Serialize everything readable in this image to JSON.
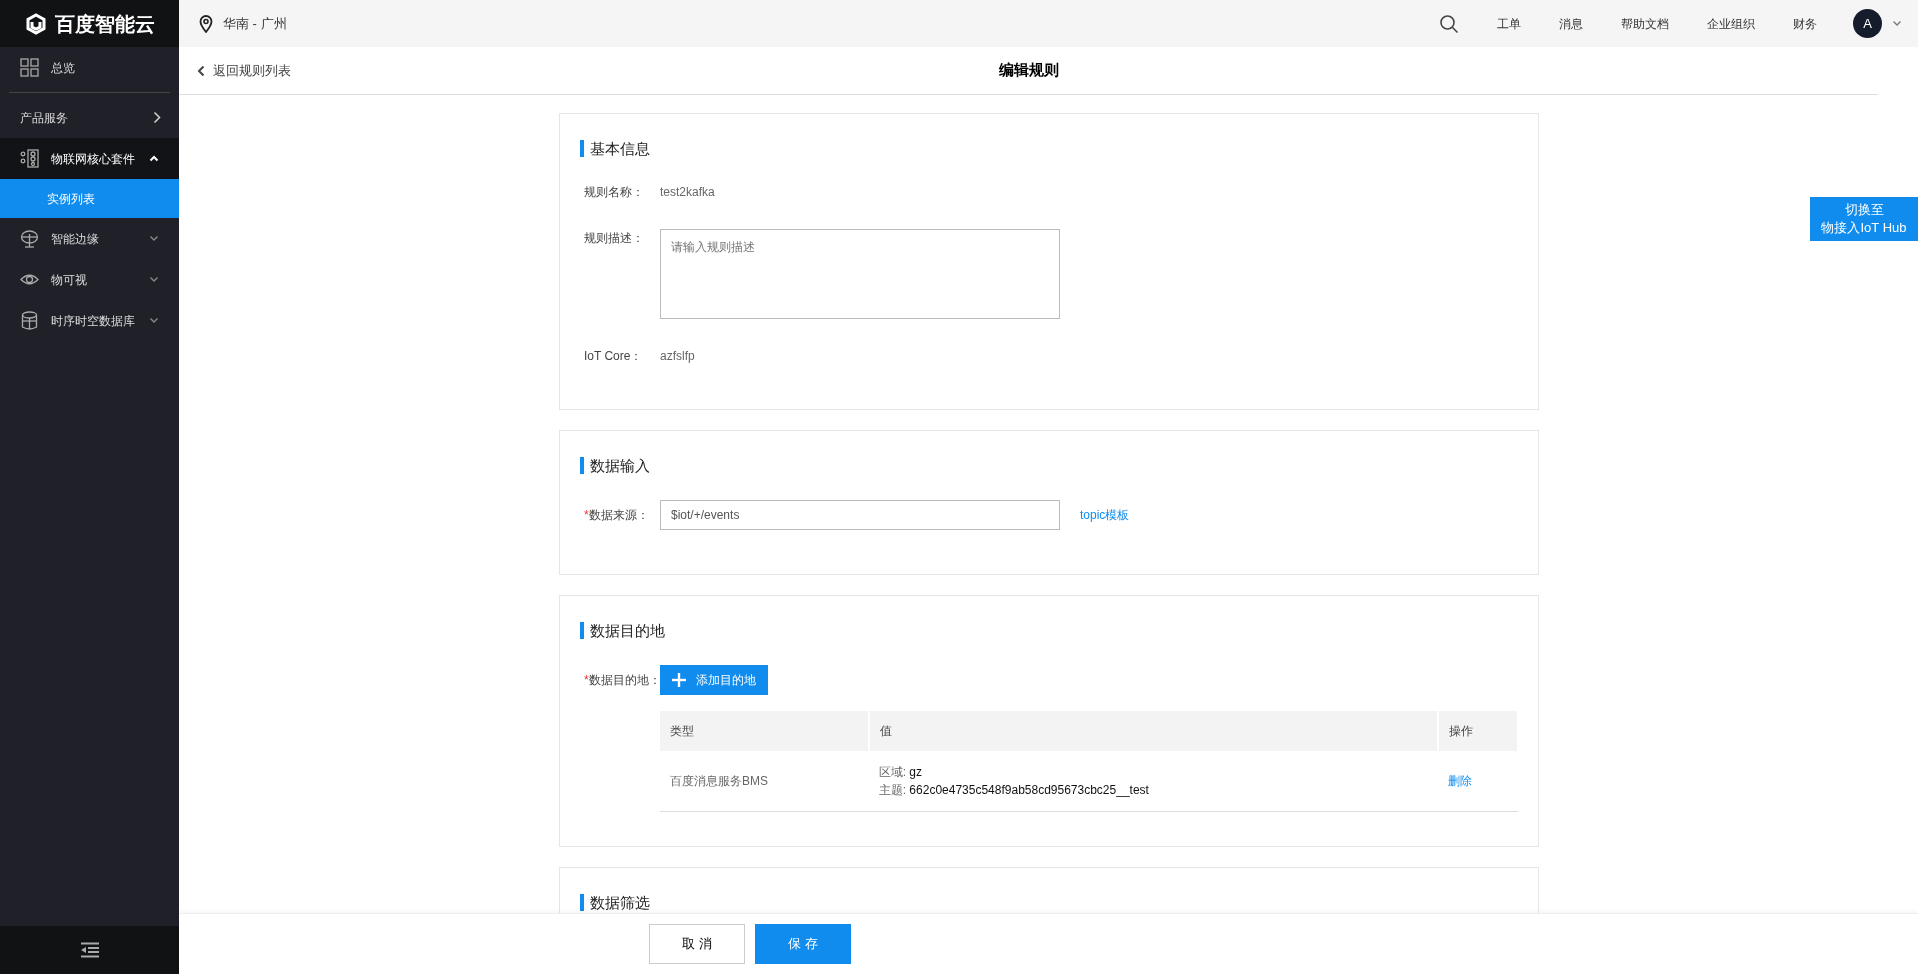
{
  "sidebar": {
    "logo": "百度智能云",
    "items": [
      {
        "kind": "link",
        "label": "总览"
      },
      {
        "kind": "section",
        "label": "产品服务"
      },
      {
        "kind": "group",
        "label": "物联网核心套件",
        "expanded": true,
        "children": [
          {
            "label": "实例列表",
            "selected": true
          }
        ]
      },
      {
        "kind": "group",
        "label": "智能边缘",
        "expanded": false
      },
      {
        "kind": "group",
        "label": "物可视",
        "expanded": false
      },
      {
        "kind": "group",
        "label": "时序时空数据库",
        "expanded": false
      }
    ]
  },
  "topbar": {
    "region": "华南 - 广州",
    "links": [
      "工单",
      "消息",
      "帮助文档",
      "企业组织",
      "财务"
    ],
    "avatar": "A"
  },
  "header": {
    "back": "返回规则列表",
    "title": "编辑规则"
  },
  "switch_button": [
    "切换至",
    "物接入IoT Hub"
  ],
  "sections": [
    {
      "kind": "fields",
      "title": "基本信息",
      "fields": [
        {
          "kind": "text",
          "label": "规则名称：",
          "value": "test2kafka"
        },
        {
          "kind": "textarea",
          "label": "规则描述：",
          "placeholder": "请输入规则描述"
        },
        {
          "kind": "text",
          "label": "IoT Core：",
          "value": "azfslfp"
        }
      ]
    },
    {
      "kind": "fields",
      "title": "数据输入",
      "fields": [
        {
          "kind": "input",
          "required_mark": "*",
          "label": "数据来源：",
          "value": "$iot/+/events",
          "link": "topic模板"
        }
      ]
    },
    {
      "kind": "destinations",
      "title": "数据目的地",
      "required_mark": "*",
      "label": "数据目的地：",
      "add_button": "添加目的地",
      "table": {
        "columns": [
          "类型",
          "值",
          "操作"
        ],
        "rows": [
          {
            "type": "百度消息服务BMS",
            "values": [
              {
                "key": "区域:",
                "value": "gz"
              },
              {
                "key": "主题:",
                "value": "662c0e4735c548f9ab58cd95673cbc25__test"
              }
            ],
            "action": "删除"
          }
        ]
      }
    },
    {
      "kind": "title_only",
      "title": "数据筛选"
    }
  ],
  "footer": {
    "cancel": "取 消",
    "save": "保 存"
  }
}
